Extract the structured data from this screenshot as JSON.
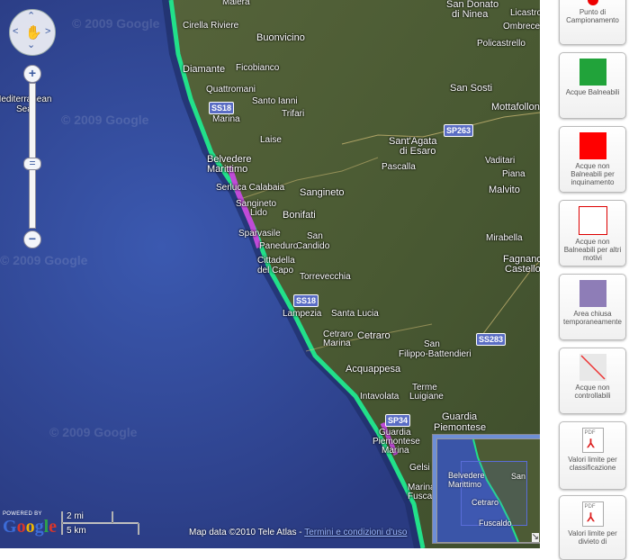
{
  "map": {
    "places": [
      {
        "name": "Maiera",
        "big": false
      },
      {
        "name": "Cirella Riviere",
        "big": false
      },
      {
        "name": "Buonvicino",
        "big": true
      },
      {
        "name": "Diamante",
        "big": true
      },
      {
        "name": "Ficobianco",
        "big": false
      },
      {
        "name": "Quattromani",
        "big": false
      },
      {
        "name": "Santo Ianni",
        "big": false
      },
      {
        "name": "Marina",
        "big": false
      },
      {
        "name": "Trifari",
        "big": false
      },
      {
        "name": "Laise",
        "big": false
      },
      {
        "name": "Belvedere",
        "big": true
      },
      {
        "name": "Marittimo",
        "big": true
      },
      {
        "name": "Serluca Calabaia",
        "big": false
      },
      {
        "name": "Sangineto",
        "big": true
      },
      {
        "name": "Sangineto",
        "big": false
      },
      {
        "name": "Lido",
        "big": false
      },
      {
        "name": "Bonifati",
        "big": true
      },
      {
        "name": "Sparvasile",
        "big": false
      },
      {
        "name": "San",
        "big": false
      },
      {
        "name": "Candido",
        "big": false
      },
      {
        "name": "Paneduro",
        "big": false
      },
      {
        "name": "Cittadella",
        "big": false
      },
      {
        "name": "del Capo",
        "big": false
      },
      {
        "name": "Torrevecchia",
        "big": false
      },
      {
        "name": "Lampezia",
        "big": false
      },
      {
        "name": "Santa Lucia",
        "big": false
      },
      {
        "name": "Cetraro",
        "big": true
      },
      {
        "name": "Cetraro",
        "big": false
      },
      {
        "name": "Marina",
        "big": false
      },
      {
        "name": "San",
        "big": false
      },
      {
        "name": "Filippo-Battendieri",
        "big": false
      },
      {
        "name": "Acquappesa",
        "big": true
      },
      {
        "name": "Intavolata",
        "big": false
      },
      {
        "name": "Terme",
        "big": false
      },
      {
        "name": "Luigiane",
        "big": false
      },
      {
        "name": "Guardia",
        "big": true
      },
      {
        "name": "Piemontese",
        "big": true
      },
      {
        "name": "Guardia",
        "big": false
      },
      {
        "name": "Piemontese",
        "big": false
      },
      {
        "name": "Marina",
        "big": false
      },
      {
        "name": "Gelsi",
        "big": false
      },
      {
        "name": "Marina",
        "big": false
      },
      {
        "name": "Fusca",
        "big": false
      },
      {
        "name": "San Donato",
        "big": true
      },
      {
        "name": "di Ninea",
        "big": true
      },
      {
        "name": "Licastro",
        "big": false
      },
      {
        "name": "Ombrece",
        "big": false
      },
      {
        "name": "Policastrello",
        "big": false
      },
      {
        "name": "San Sosti",
        "big": true
      },
      {
        "name": "Mottafollone",
        "big": true
      },
      {
        "name": "Sant'Agata",
        "big": true
      },
      {
        "name": "di Esaro",
        "big": true
      },
      {
        "name": "Pascalla",
        "big": false
      },
      {
        "name": "Vaditari",
        "big": false
      },
      {
        "name": "Piana",
        "big": false
      },
      {
        "name": "Malvito",
        "big": true
      },
      {
        "name": "Mirabella",
        "big": false
      },
      {
        "name": "Fagnano",
        "big": true
      },
      {
        "name": "Castello",
        "big": true
      }
    ],
    "roads": [
      "SS18",
      "SS18",
      "SP263",
      "SS283",
      "SP34"
    ],
    "sea_label": [
      "Mediterranean",
      "Sea"
    ],
    "watermark": "© 2009 Google",
    "logo_powered": "POWERED BY",
    "logo_text": "Google",
    "scale": {
      "mi": "2 mi",
      "km": "5 km"
    },
    "copyright_prefix": "Map data ©2010 Tele Atlas - ",
    "copyright_link": "Termini e condizioni d'uso",
    "overview": {
      "labels": [
        "Belvedere",
        "Marittimo",
        "San",
        "Cetraro",
        "Fuscaldo"
      ]
    }
  },
  "legend": {
    "items": [
      {
        "label": "Punto di Campionamento",
        "color": "#ee0000"
      },
      {
        "label": "Acque Balneabili",
        "color": "#21a33a"
      },
      {
        "label": "Acque non Balneabili per inquinamento",
        "color": "#ff0000"
      },
      {
        "label": "Acque non Balneabili per altri motivi",
        "color": "#ffffff"
      },
      {
        "label": "Area chiusa temporaneamente",
        "color": "#8e7db7"
      },
      {
        "label": "Acque non controllabili",
        "color": "#e8e8e8"
      },
      {
        "label": "Valori limite per classificazione",
        "icon": "pdf-icon"
      },
      {
        "label": "Valori limite per divieto di",
        "icon": "pdf-icon"
      }
    ]
  },
  "colors": {
    "sea": "#2b3f86",
    "coast_green": "#22e08a",
    "coast_purple": "#c04bd8"
  }
}
